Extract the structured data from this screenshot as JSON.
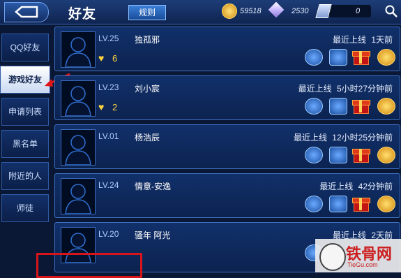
{
  "header": {
    "title": "好友",
    "rules_label": "规则",
    "coins": "59518",
    "diamonds": "2530",
    "tickets": "0"
  },
  "sidebar": {
    "tabs": [
      {
        "label": "QQ好友"
      },
      {
        "label": "游戏好友",
        "active": true
      },
      {
        "label": "申请列表"
      },
      {
        "label": "黑名单"
      },
      {
        "label": "附近的人"
      },
      {
        "label": "师徒"
      }
    ]
  },
  "friends": [
    {
      "level": "LV.25",
      "name": "独孤邪",
      "hearts": "6",
      "online_label": "最近上线",
      "online_time": "1天前"
    },
    {
      "level": "LV.23",
      "name": "刘小宸",
      "hearts": "2",
      "online_label": "最近上线",
      "online_time": "5小时27分钟前"
    },
    {
      "level": "LV.01",
      "name": "杨浩辰",
      "hearts": "",
      "online_label": "最近上线",
      "online_time": "12小时25分钟前"
    },
    {
      "level": "LV.24",
      "name": "情意-安逸",
      "hearts": "",
      "online_label": "最近上线",
      "online_time": "42分钟前"
    },
    {
      "level": "LV.20",
      "name": "骚年 阿光",
      "hearts": "",
      "online_label": "最近上线",
      "online_time": "2天前"
    }
  ],
  "watermark": {
    "text": "铁骨网",
    "sub": "TieGu.com"
  },
  "colors": {
    "accent": "#3e6fbf",
    "highlight": "#d8151b",
    "gold": "#ffd23f"
  }
}
